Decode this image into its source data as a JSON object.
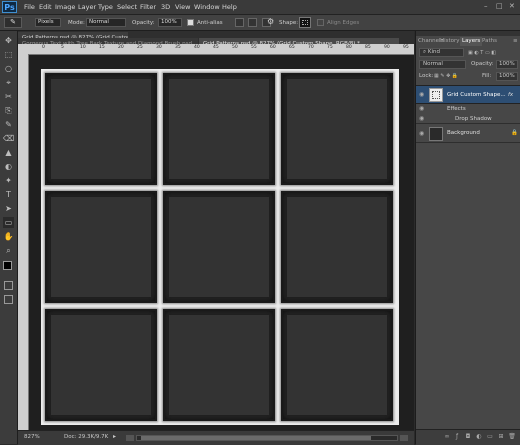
{
  "menu": {
    "logo": "Ps",
    "items": [
      "File",
      "Edit",
      "Image",
      "Layer",
      "Type",
      "Select",
      "Filter",
      "3D",
      "View",
      "Window",
      "Help"
    ],
    "window_controls": [
      "–",
      "□",
      "✕"
    ]
  },
  "options_bar": {
    "tool_preset": "✎",
    "shape_type": "Pixels",
    "mode_label": "Mode:",
    "mode_value": "Normal",
    "opacity_label": "Opacity:",
    "opacity_value": "100%",
    "antialias_label": "Anti-alias",
    "shape_label": "Shape:",
    "align_label": "Align Edges"
  },
  "tabs": [
    {
      "label": "Grid Patterns.psd @ 827% (Grid Custom Shape, RGB/8) *",
      "active": false
    },
    {
      "label": "Gorgeous Text with Tree Bark Texture and Diamond Brush.psd",
      "active": false
    },
    {
      "label": "Grid Patterns.psd @ 827% (Grid Custom Shape, RGB/8) *",
      "active": true
    }
  ],
  "ruler_marks": [
    "0",
    "5",
    "10",
    "15",
    "20",
    "25",
    "30",
    "35",
    "40",
    "45",
    "50",
    "55",
    "60",
    "65",
    "70",
    "75",
    "80",
    "85",
    "90",
    "95"
  ],
  "status": {
    "zoom": "827%",
    "doc": "Doc: 29.3K/9.7K"
  },
  "panel": {
    "tabs": [
      "Channels",
      "History",
      "Layers",
      "Paths"
    ],
    "active_tab": "Layers",
    "kind_label": "Kind",
    "blend_mode": "Normal",
    "opacity_label": "Opacity:",
    "opacity_value": "100%",
    "lock_label": "Lock:",
    "fill_label": "Fill:",
    "fill_value": "100%",
    "layers": [
      {
        "name": "Grid Custom Shape...",
        "fx": "fx",
        "selected": true
      },
      {
        "name": "Effects",
        "sub": true
      },
      {
        "name": "Drop Shadow",
        "sub2": true
      },
      {
        "name": "Background",
        "selected": false
      }
    ]
  },
  "tools": [
    "✥",
    "⬚",
    "○",
    "⌖",
    "✂",
    "⎘",
    "✎",
    "⌫",
    "▲",
    "◐",
    "✦",
    "T",
    "➤",
    "▭",
    "✋",
    "⌕"
  ],
  "colors": {
    "ui_dark": "#2b2b2b",
    "panel_bg": "#474747",
    "accent_blue": "#2d4e73",
    "doc_white": "#ececec",
    "cell_dark": "#2c2c2c"
  }
}
